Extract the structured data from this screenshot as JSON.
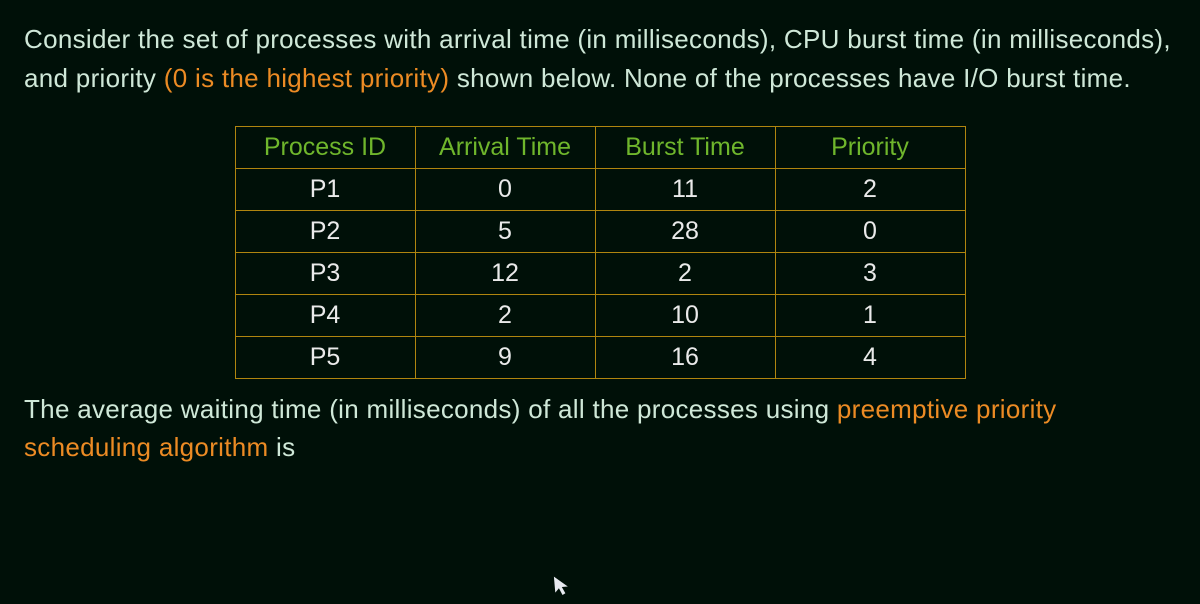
{
  "intro": {
    "p1": "Consider the set of processes with arrival time (in milliseconds), CPU burst time (in milliseconds), and priority ",
    "hl": "(0 is the highest priority)",
    "p2": " shown below. None of the processes have I/O burst time."
  },
  "table": {
    "headers": [
      "Process ID",
      "Arrival Time",
      "Burst Time",
      "Priority"
    ],
    "rows": [
      [
        "P1",
        "0",
        "11",
        "2"
      ],
      [
        "P2",
        "5",
        "28",
        "0"
      ],
      [
        "P3",
        "12",
        "2",
        "3"
      ],
      [
        "P4",
        "2",
        "10",
        "1"
      ],
      [
        "P5",
        "9",
        "16",
        "4"
      ]
    ]
  },
  "outro": {
    "p1": "The average waiting time (in milliseconds) of all the processes using ",
    "hl": "preemptive priority scheduling algorithm",
    "p2": " is"
  }
}
